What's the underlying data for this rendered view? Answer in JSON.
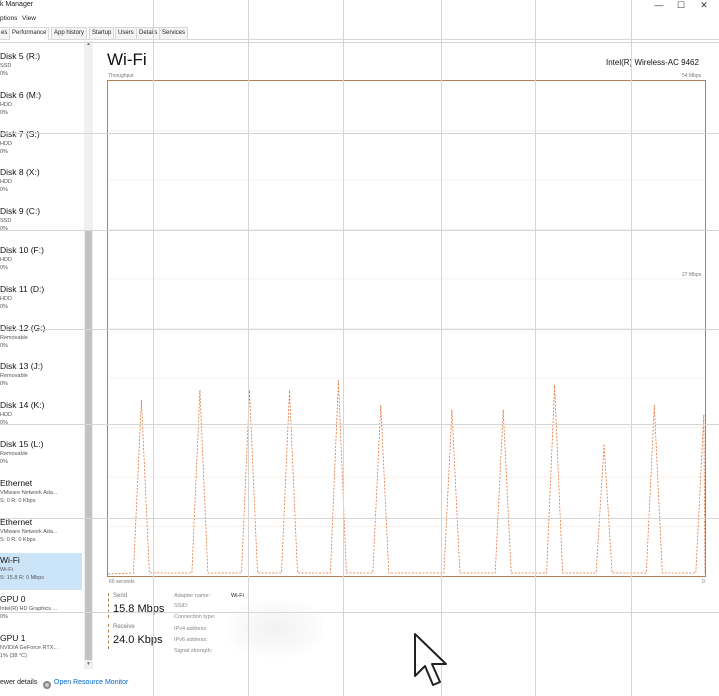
{
  "window": {
    "title": "k Manager",
    "buttons": {
      "minimize": "—",
      "maximize": "☐",
      "close": "✕"
    }
  },
  "menu": [
    "ptions",
    "View"
  ],
  "tabs": [
    {
      "label": "es",
      "active": false
    },
    {
      "label": "Performance",
      "active": true
    },
    {
      "label": "App history",
      "active": false
    },
    {
      "label": "Startup",
      "active": false
    },
    {
      "label": "Users",
      "active": false
    },
    {
      "label": "Details",
      "active": false
    },
    {
      "label": "Services",
      "active": false
    }
  ],
  "sidebar": {
    "items": [
      {
        "name": "Disk 5 (R:)",
        "sub": "SSD",
        "value": "0%"
      },
      {
        "name": "Disk 6 (M:)",
        "sub": "HDD",
        "value": "0%"
      },
      {
        "name": "Disk 7 (S:)",
        "sub": "HDD",
        "value": "0%"
      },
      {
        "name": "Disk 8 (X:)",
        "sub": "HDD",
        "value": "0%"
      },
      {
        "name": "Disk 9 (C:)",
        "sub": "SSD",
        "value": "0%"
      },
      {
        "name": "Disk 10 (F:)",
        "sub": "HDD",
        "value": "0%"
      },
      {
        "name": "Disk 11 (D:)",
        "sub": "HDD",
        "value": "0%"
      },
      {
        "name": "Disk 12 (G:)",
        "sub": "Removable",
        "value": "0%"
      },
      {
        "name": "Disk 13 (J:)",
        "sub": "Removable",
        "value": "0%"
      },
      {
        "name": "Disk 14 (K:)",
        "sub": "HDD",
        "value": "0%"
      },
      {
        "name": "Disk 15 (L:)",
        "sub": "Removable",
        "value": "0%"
      },
      {
        "name": "Ethernet",
        "sub": "VMware Network Ada...",
        "value": "S: 0 R: 0 Kbps"
      },
      {
        "name": "Ethernet",
        "sub": "VMware Network Ada...",
        "value": "S: 0 R: 0 Kbps"
      },
      {
        "name": "Wi-Fi",
        "sub": "Wi-Fi",
        "value": "S: 15.8 R: 0 Mbps",
        "selected": true
      },
      {
        "name": "GPU 0",
        "sub": "Intel(R) HD Graphics ...",
        "value": "0%"
      },
      {
        "name": "GPU 1",
        "sub": "NVIDIA GeForce RTX...",
        "value": "1% (38 °C)"
      }
    ]
  },
  "main": {
    "title": "Wi-Fi",
    "adapter": "Intel(R) Wireless-AC 9462",
    "graph": {
      "ylabel": "Throughput",
      "ymax_label": "54 Mbps",
      "ymid_label": "27 Mbps",
      "x_left_label": "60 seconds",
      "x_right_label": "0",
      "line_color": "#e0743a",
      "frame_color": "#b08050",
      "spikes": [
        {
          "t": 0.056,
          "v": 0.35
        },
        {
          "t": 0.154,
          "v": 0.37
        },
        {
          "t": 0.237,
          "v": 0.37
        },
        {
          "t": 0.304,
          "v": 0.37
        },
        {
          "t": 0.386,
          "v": 0.39
        },
        {
          "t": 0.457,
          "v": 0.34
        },
        {
          "t": 0.576,
          "v": 0.33
        },
        {
          "t": 0.662,
          "v": 0.33
        },
        {
          "t": 0.748,
          "v": 0.38
        },
        {
          "t": 0.831,
          "v": 0.26
        },
        {
          "t": 0.915,
          "v": 0.34
        },
        {
          "t": 0.998,
          "v": 0.32
        }
      ]
    },
    "send": {
      "label": "Send",
      "value": "15.8 Mbps"
    },
    "receive": {
      "label": "Receive",
      "value": "24.0 Kbps"
    },
    "info": [
      {
        "label": "Adapter name:",
        "value": "Wi-Fi"
      },
      {
        "label": "SSID:",
        "value": ""
      },
      {
        "label": "Connection type:",
        "value": ""
      },
      {
        "label": "IPv4 address:",
        "value": ""
      },
      {
        "label": "IPv6 address:",
        "value": ""
      },
      {
        "label": "Signal strength:",
        "value": ""
      }
    ]
  },
  "footer": {
    "details": "ewer details",
    "resource_monitor": "Open Resource Monitor",
    "link_color": "#0066cc"
  }
}
